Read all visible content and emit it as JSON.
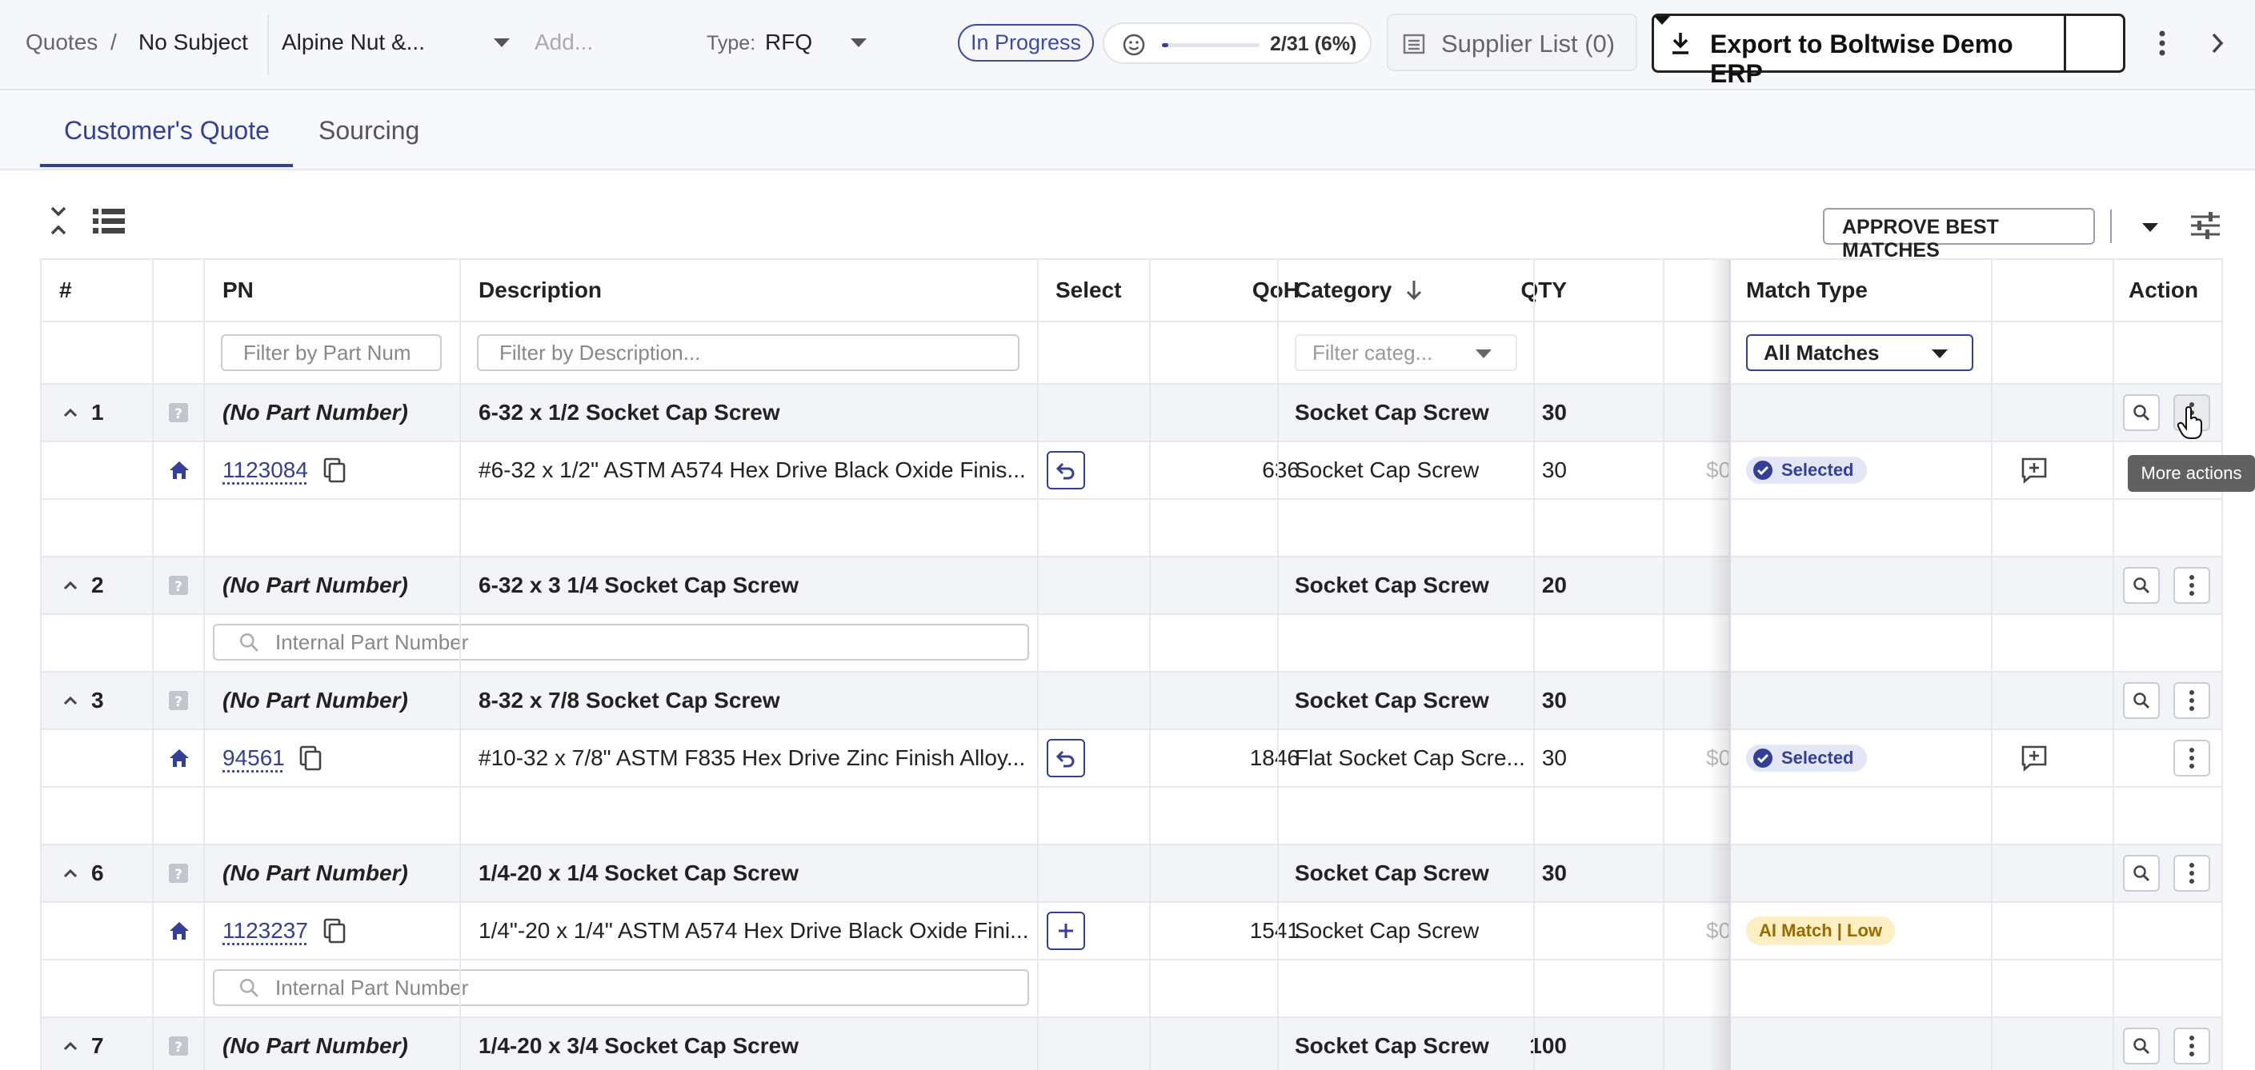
{
  "breadcrumb": {
    "root": "Quotes",
    "sep": "/",
    "current": "No Subject"
  },
  "header": {
    "customer": "Alpine Nut &...",
    "add_placeholder": "Add...",
    "type_label": "Type:",
    "type_value": "RFQ",
    "status": "In Progress",
    "progress_text": "2/31 (6%)",
    "progress_fraction": 0.065,
    "supplier_list": "Supplier List (0)",
    "export_label": "Export to Boltwise Demo ERP"
  },
  "tabs": [
    {
      "label": "Customer's Quote",
      "active": true
    },
    {
      "label": "Sourcing",
      "active": false
    }
  ],
  "toolbar": {
    "approve_label": "APPROVE BEST MATCHES"
  },
  "columns": {
    "num": "#",
    "pn": "PN",
    "description": "Description",
    "select": "Select",
    "qoh": "QoH",
    "category": "Category",
    "qty": "QTY",
    "match_type": "Match Type",
    "action": "Action"
  },
  "filters": {
    "pn_placeholder": "Filter by Part Num",
    "desc_placeholder": "Filter by Description...",
    "category_placeholder": "Filter categ...",
    "match_type_value": "All Matches"
  },
  "rows": [
    {
      "num": "1",
      "pn": "(No Part Number)",
      "description": "6-32 x 1/2 Socket Cap Screw",
      "category": "Socket Cap Screw",
      "qty": "30",
      "match": {
        "pn": "1123084",
        "description": "#6-32 x 1/2\" ASTM A574 Hex Drive Black Oxide Finis...",
        "qoh": "636",
        "category": "Socket Cap Screw",
        "qty": "30",
        "price": "$0",
        "badge": "Selected"
      }
    },
    {
      "num": "2",
      "pn": "(No Part Number)",
      "description": "6-32 x 3 1/4 Socket Cap Screw",
      "category": "Socket Cap Screw",
      "qty": "20",
      "internal_placeholder": "Internal Part Number"
    },
    {
      "num": "3",
      "pn": "(No Part Number)",
      "description": "8-32 x 7/8 Socket Cap Screw",
      "category": "Socket Cap Screw",
      "qty": "30",
      "match": {
        "pn": "94561",
        "description": "#10-32 x 7/8\" ASTM F835 Hex Drive Zinc Finish Alloy...",
        "qoh": "1846",
        "category": "Flat Socket Cap Scre...",
        "qty": "30",
        "price": "$0",
        "badge": "Selected"
      }
    },
    {
      "num": "6",
      "pn": "(No Part Number)",
      "description": "1/4-20 x 1/4 Socket Cap Screw",
      "category": "Socket Cap Screw",
      "qty": "30",
      "match": {
        "pn": "1123237",
        "description": "1/4\"-20 x 1/4\" ASTM A574 Hex Drive Black Oxide Fini...",
        "qoh": "1541",
        "category": "Socket Cap Screw",
        "qty": "",
        "price": "$0",
        "badge": "AI Match | Low"
      },
      "internal_placeholder": "Internal Part Number"
    },
    {
      "num": "7",
      "pn": "(No Part Number)",
      "description": "1/4-20 x 3/4 Socket Cap Screw",
      "category": "Socket Cap Screw",
      "qty": "100"
    }
  ],
  "tooltip": "More actions",
  "colors": {
    "accent": "#343f97",
    "selected_badge_bg": "#e3e6f5",
    "ai_badge_bg": "#fbefc3"
  }
}
